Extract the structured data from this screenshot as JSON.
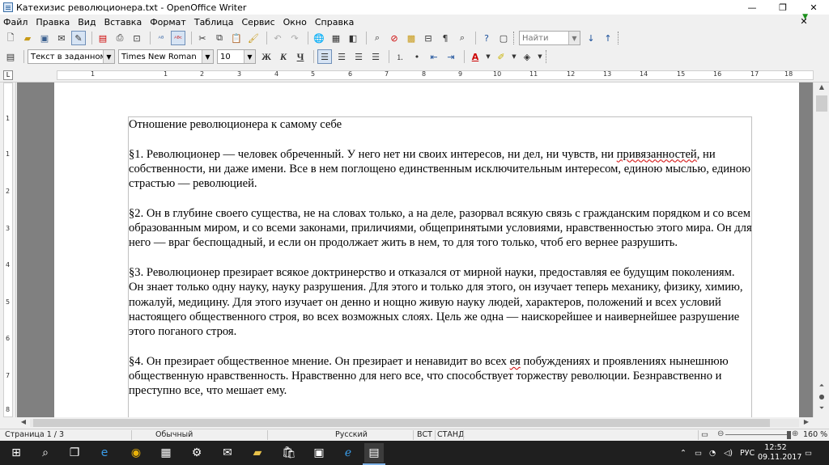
{
  "window": {
    "title": "Катехизис революционера.txt - OpenOffice Writer",
    "minimize": "—",
    "restore": "❐",
    "close": "✕"
  },
  "menu": {
    "items": [
      "Файл",
      "Правка",
      "Вид",
      "Вставка",
      "Формат",
      "Таблица",
      "Сервис",
      "Окно",
      "Справка"
    ],
    "doc_close": "✕"
  },
  "toolbar": {
    "find_placeholder": "Найти"
  },
  "format": {
    "style": "Текст в заданном фор",
    "font": "Times New Roman",
    "size": "10",
    "bold": "Ж",
    "italic": "К",
    "underline": "Ч"
  },
  "ruler": {
    "h_numbers": [
      "1",
      "1",
      "2",
      "3",
      "4",
      "5",
      "6",
      "7",
      "8",
      "9",
      "10",
      "11",
      "12",
      "13",
      "14",
      "15",
      "16",
      "17",
      "18"
    ],
    "v_numbers": [
      "1",
      "1",
      "2",
      "3",
      "4",
      "5",
      "6",
      "7",
      "8"
    ]
  },
  "document": {
    "heading": "Отношение революционера к самому себе",
    "p1_before": "§1. Революционер — человек обреченный. У него нет ни своих интересов, ни дел, ни чувств, ни ",
    "p1_misspelled": "привязанностей",
    "p1_after": ", ни собственности, ни даже имени. Все в нем поглощено единственным исключительным интересом, единою мыслью, единою страстью — революцией.",
    "p2": "§2. Он в глубине своего существа, не на словах только, а на деле, разорвал всякую связь с гражданским порядком и со всем образованным миром, и со всеми законами, приличиями, общепринятыми условиями, нравственностью этого мира. Он для него — враг беспощадный, и если он продолжает жить в нем, то для того только, чтоб его вернее разрушить.",
    "p3": "§3. Революционер презирает всякое доктринерство и отказался от мирной науки, предоставляя ее будущим поколениям. Он знает только одну науку, науку разрушения. Для этого и только для этого, он изучает теперь механику, физику, химию, пожалуй, медицину. Для этого изучает он денно и нощно живую науку людей, характеров, положений и всех условий настоящего общественного строя, во всех возможных слоях. Цель же одна — наискорейшее и наивернейшее разрушение этого поганого строя.",
    "p4_before": "§4. Он презирает общественное мнение. Он презирает и ненавидит во всех ",
    "p4_misspelled": "ея",
    "p4_after": " побуждениях и проявлениях нынешнюю общественную нравственность. Нравственно для него все, что способствует торжеству революции. Безнравственно и преступно все, что мешает ему."
  },
  "status": {
    "page": "Страница  1 / 3",
    "style": "Обычный",
    "language": "Русский",
    "insert_mode": "ВСТ",
    "selection_mode": "СТАНД",
    "zoom": "160 %"
  },
  "taskbar": {
    "search_icon": "search-icon",
    "language": "РУС",
    "time": "12:52",
    "date": "09.11.2017"
  },
  "colors": {
    "accent": "#3a6ea5",
    "taskbar_bg": "#1f1f1f",
    "spell_error": "#d00000"
  }
}
